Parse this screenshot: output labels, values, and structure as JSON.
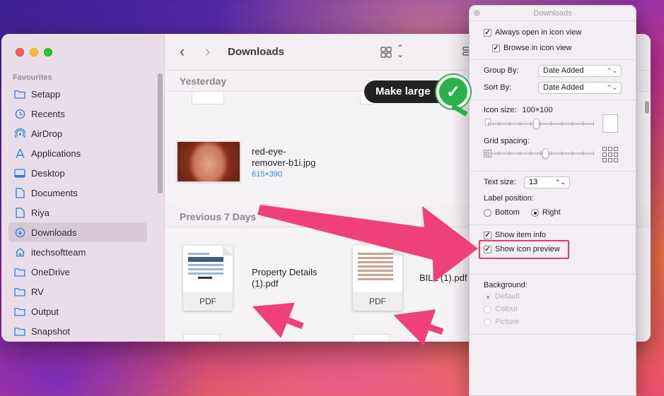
{
  "finder": {
    "title": "Downloads",
    "sidebar": {
      "section": "Favourites",
      "items": [
        {
          "label": "Setapp",
          "icon": "folder-icon"
        },
        {
          "label": "Recents",
          "icon": "clock-icon"
        },
        {
          "label": "AirDrop",
          "icon": "airdrop-icon"
        },
        {
          "label": "Applications",
          "icon": "applications-icon"
        },
        {
          "label": "Desktop",
          "icon": "desktop-icon"
        },
        {
          "label": "Documents",
          "icon": "document-icon"
        },
        {
          "label": "Riya",
          "icon": "document-icon"
        },
        {
          "label": "Downloads",
          "icon": "download-icon"
        },
        {
          "label": "itechsoftteam",
          "icon": "home-icon"
        },
        {
          "label": "OneDrive",
          "icon": "folder-icon"
        },
        {
          "label": "RV",
          "icon": "folder-icon"
        },
        {
          "label": "Output",
          "icon": "folder-icon"
        },
        {
          "label": "Snapshot",
          "icon": "folder-icon"
        }
      ]
    },
    "groups": {
      "yesterday": "Yesterday",
      "previous": "Previous 7 Days"
    },
    "files": {
      "photo_name_line1": "red-eye-",
      "photo_name_line2": "remover-b1i.jpg",
      "photo_meta": "615×390",
      "pdf1_line1": "Property Details",
      "pdf1_line2": "(1).pdf",
      "pdf1_label": "PDF",
      "pdf2_name": "BILL (1).pdf",
      "pdf2_label": "PDF"
    }
  },
  "panel": {
    "title": "Downloads",
    "always_open": "Always open in icon view",
    "browse": "Browse in icon view",
    "group_by_label": "Group By:",
    "group_by_value": "Date Added",
    "sort_by_label": "Sort By:",
    "sort_by_value": "Date Added",
    "icon_size_label": "Icon size:",
    "icon_size_value": "100×100",
    "grid_spacing_label": "Grid spacing:",
    "text_size_label": "Text size:",
    "text_size_value": "13",
    "label_position_label": "Label position:",
    "bottom": "Bottom",
    "right": "Right",
    "show_item_info": "Show item info",
    "show_icon_preview": "Show icon preview",
    "background_label": "Background:",
    "bg_default": "Default",
    "bg_colour": "Colour",
    "bg_picture": "Picture"
  },
  "annotation": {
    "callout": "Make large"
  },
  "colors": {
    "accent": "#2f7de1",
    "arrow": "#f0407a",
    "badge": "#2bb14a"
  }
}
